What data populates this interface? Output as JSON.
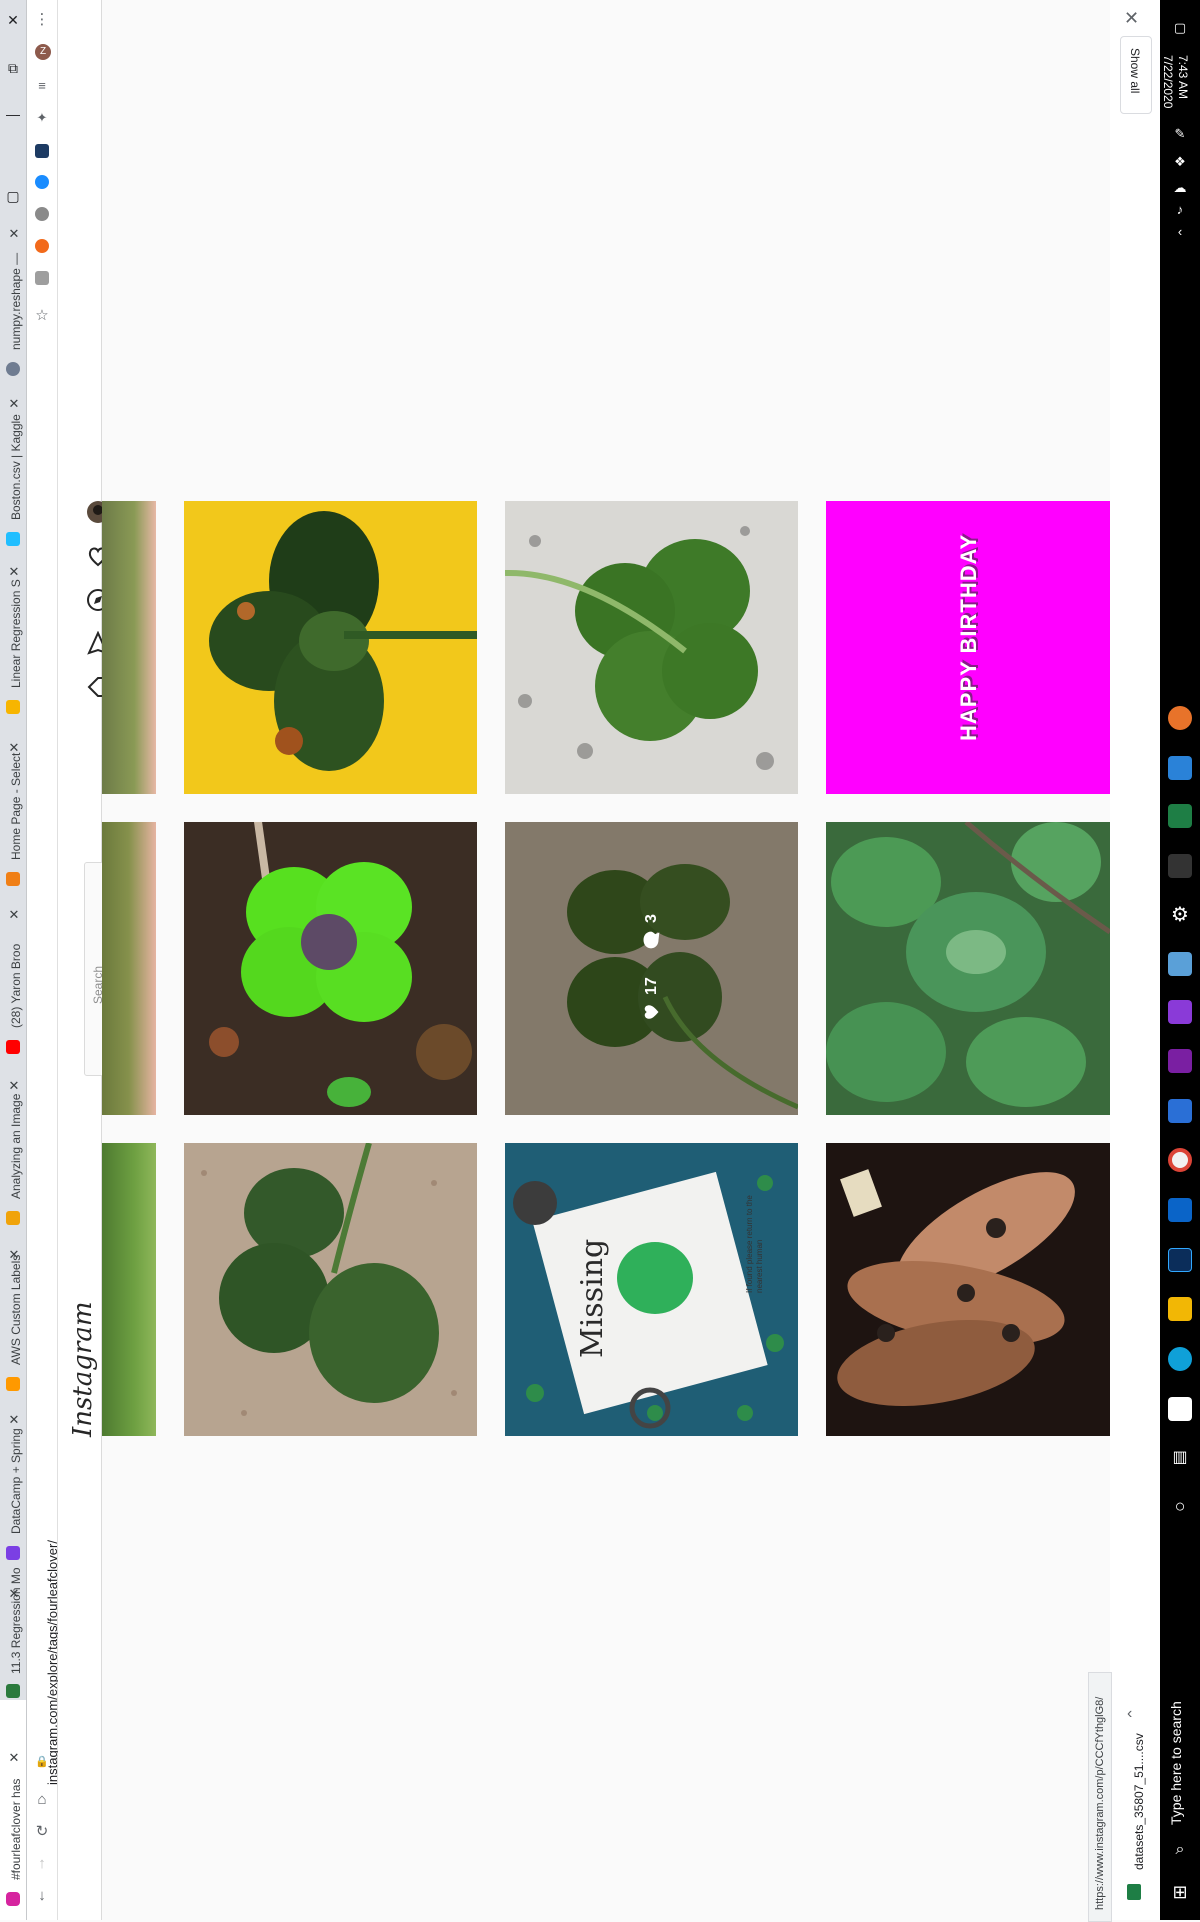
{
  "tabs": [
    {
      "title": "#fourleafclover has",
      "favicon_color": "#d6249f",
      "active": true
    },
    {
      "title": "11.3 Regression Mo",
      "favicon_color": "#2b7a3d",
      "active": false
    },
    {
      "title": "DataCamp + Spring",
      "favicon_color": "#7b3fe4",
      "active": false
    },
    {
      "title": "AWS Custom Labels",
      "favicon_color": "#ff9900",
      "active": false
    },
    {
      "title": "Analyzing an Image",
      "favicon_color": "#f0a30a",
      "active": false
    },
    {
      "title": "(28) Yaron Broo",
      "favicon_color": "#ff0000",
      "active": false
    },
    {
      "title": "Home Page - Select",
      "favicon_color": "#f07f16",
      "active": false
    },
    {
      "title": "Linear Regression S",
      "favicon_color": "#f7b500",
      "active": false
    },
    {
      "title": "Boston.csv | Kaggle",
      "favicon_color": "#20beff",
      "active": false
    },
    {
      "title": "numpy.reshape —",
      "favicon_color": "#6f7c91",
      "active": false
    }
  ],
  "address_bar": {
    "url": "instagram.com/explore/tags/fourleafclover/"
  },
  "profile_initial": "Z",
  "instagram": {
    "logo": "Instagram",
    "search_placeholder": "Search"
  },
  "hovered_post": {
    "likes": "17",
    "comments": "3"
  },
  "posts": [
    {
      "row": 0,
      "col": 0,
      "desc": "clover-yellow"
    },
    {
      "row": 0,
      "col": 1,
      "desc": "clover-granite"
    },
    {
      "row": 0,
      "col": 2,
      "desc": "happy-birthday"
    },
    {
      "row": 1,
      "col": 0,
      "desc": "clover-bright"
    },
    {
      "row": 1,
      "col": 1,
      "desc": "clover-hovered"
    },
    {
      "row": 1,
      "col": 2,
      "desc": "clover-patch"
    },
    {
      "row": 2,
      "col": 0,
      "desc": "clover-pebbles"
    },
    {
      "row": 2,
      "col": 1,
      "desc": "missing-poster"
    },
    {
      "row": 2,
      "col": 2,
      "desc": "hand-tattoos"
    }
  ],
  "birthday_text": "HAPPY BIRTHDAY",
  "missing_poster": {
    "title": "Missing",
    "note": "If found please return to the nearest human"
  },
  "downloads": {
    "show_all": "Show all",
    "file_name": "datasets_35807_51....csv"
  },
  "status_url": "https://www.instagram.com/p/CCCfYthglG8/",
  "taskbar": {
    "time": "7:43 AM",
    "date": "7/22/2020",
    "search_placeholder": "Type here to search"
  },
  "colors": {
    "instagram_bg": "#fafafa",
    "birthday_magenta": "#ff00ff",
    "clover_green": "#2f6d1f"
  }
}
